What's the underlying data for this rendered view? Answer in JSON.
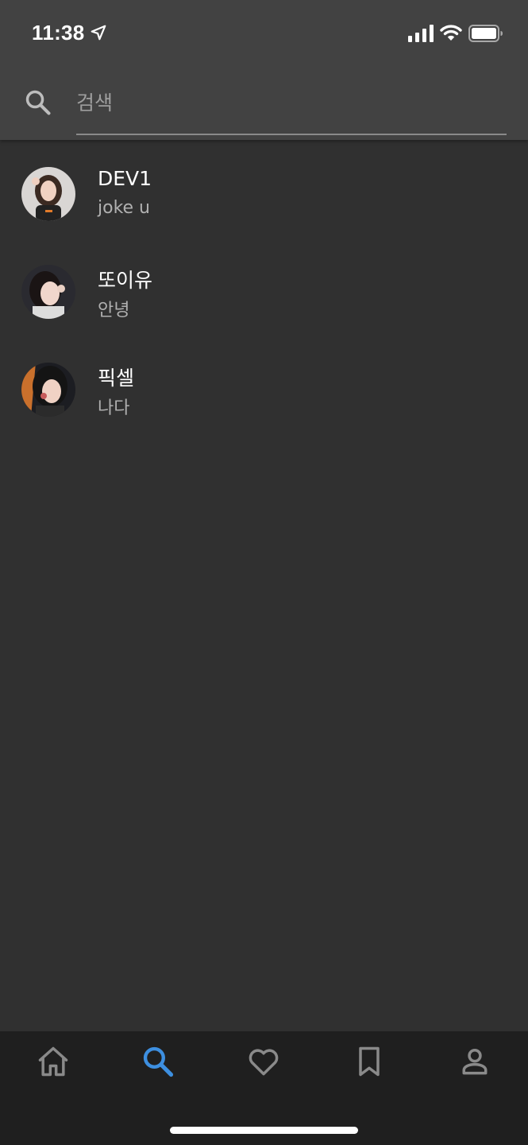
{
  "status_bar": {
    "time": "11:38",
    "icons": [
      "location-arrow-icon",
      "cellular-signal-icon",
      "wifi-icon",
      "battery-icon"
    ]
  },
  "search": {
    "placeholder": "검색",
    "value": ""
  },
  "results": [
    {
      "name": "DEV1",
      "subtitle": "joke u",
      "avatar": "avatar-photo"
    },
    {
      "name": "또이유",
      "subtitle": "안녕",
      "avatar": "avatar-photo"
    },
    {
      "name": "픽셀",
      "subtitle": "나다",
      "avatar": "avatar-photo"
    }
  ],
  "bottom_nav": {
    "items": [
      {
        "icon": "home-icon",
        "active": false
      },
      {
        "icon": "search-icon",
        "active": true
      },
      {
        "icon": "heart-icon",
        "active": false
      },
      {
        "icon": "bookmark-icon",
        "active": false
      },
      {
        "icon": "person-icon",
        "active": false
      }
    ],
    "active_color": "#3d8fe0",
    "inactive_color": "#8a8a8a"
  },
  "colors": {
    "header_bg": "#424242",
    "body_bg": "#303030",
    "nav_bg": "#1f1f1f"
  }
}
